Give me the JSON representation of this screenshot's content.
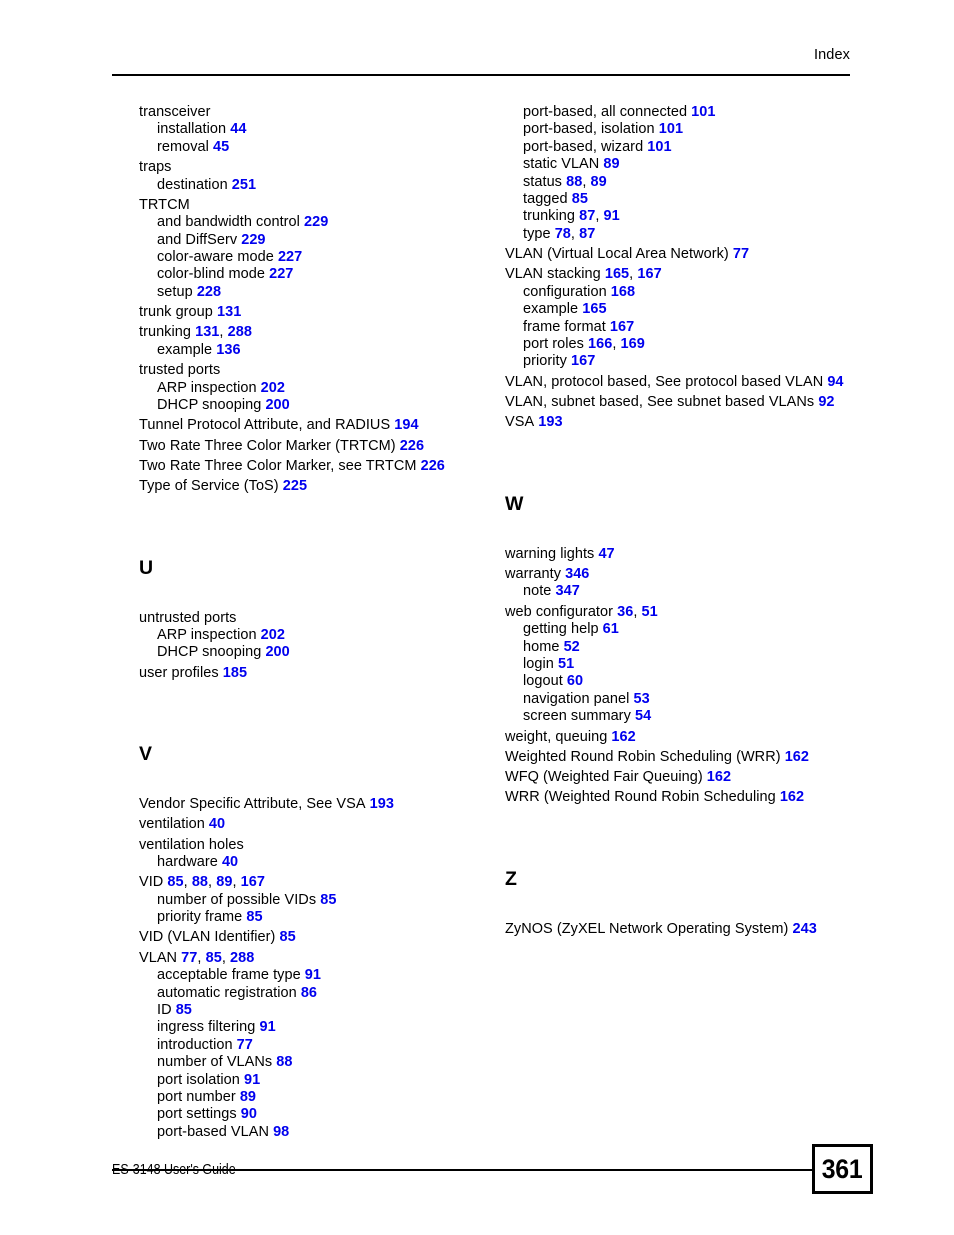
{
  "header": {
    "title": "Index"
  },
  "footer": {
    "guide_label": "ES-3148 User's Guide",
    "page_number": "361"
  },
  "colors": {
    "page_reference": "#0000ee",
    "text": "#000000",
    "background": "#ffffff"
  },
  "columns": {
    "left": [
      {
        "type": "entry",
        "level": 0,
        "text": "transceiver",
        "refs": []
      },
      {
        "type": "entry",
        "level": 1,
        "text": "installation",
        "refs": [
          "44"
        ]
      },
      {
        "type": "entry",
        "level": 1,
        "text": "removal",
        "refs": [
          "45"
        ]
      },
      {
        "type": "entry",
        "level": 0,
        "text": "traps",
        "refs": []
      },
      {
        "type": "entry",
        "level": 1,
        "text": "destination",
        "refs": [
          "251"
        ]
      },
      {
        "type": "entry",
        "level": 0,
        "text": "TRTCM",
        "refs": []
      },
      {
        "type": "entry",
        "level": 1,
        "text": "and bandwidth control",
        "refs": [
          "229"
        ]
      },
      {
        "type": "entry",
        "level": 1,
        "text": "and DiffServ",
        "refs": [
          "229"
        ]
      },
      {
        "type": "entry",
        "level": 1,
        "text": "color-aware mode",
        "refs": [
          "227"
        ]
      },
      {
        "type": "entry",
        "level": 1,
        "text": "color-blind mode",
        "refs": [
          "227"
        ]
      },
      {
        "type": "entry",
        "level": 1,
        "text": "setup",
        "refs": [
          "228"
        ]
      },
      {
        "type": "entry",
        "level": 0,
        "text": "trunk group",
        "refs": [
          "131"
        ]
      },
      {
        "type": "entry",
        "level": 0,
        "text": "trunking",
        "refs": [
          "131",
          "288"
        ]
      },
      {
        "type": "entry",
        "level": 1,
        "text": "example",
        "refs": [
          "136"
        ]
      },
      {
        "type": "entry",
        "level": 0,
        "text": "trusted ports",
        "refs": []
      },
      {
        "type": "entry",
        "level": 1,
        "text": "ARP inspection",
        "refs": [
          "202"
        ]
      },
      {
        "type": "entry",
        "level": 1,
        "text": "DHCP snooping",
        "refs": [
          "200"
        ]
      },
      {
        "type": "entry",
        "level": 0,
        "text": "Tunnel Protocol Attribute, and RADIUS",
        "refs": [
          "194"
        ]
      },
      {
        "type": "entry",
        "level": 0,
        "text": "Two Rate Three Color Marker (TRTCM)",
        "refs": [
          "226"
        ]
      },
      {
        "type": "entry",
        "level": 0,
        "text": "Two Rate Three Color Marker, see TRTCM",
        "refs": [
          "226"
        ]
      },
      {
        "type": "entry",
        "level": 0,
        "text": "Type of Service (ToS)",
        "refs": [
          "225"
        ]
      },
      {
        "type": "heading",
        "text": "U"
      },
      {
        "type": "entry",
        "level": 0,
        "text": "untrusted ports",
        "refs": []
      },
      {
        "type": "entry",
        "level": 1,
        "text": "ARP inspection",
        "refs": [
          "202"
        ]
      },
      {
        "type": "entry",
        "level": 1,
        "text": "DHCP snooping",
        "refs": [
          "200"
        ]
      },
      {
        "type": "entry",
        "level": 0,
        "text": "user profiles",
        "refs": [
          "185"
        ]
      },
      {
        "type": "heading",
        "text": "V"
      },
      {
        "type": "entry",
        "level": 0,
        "text": "Vendor Specific Attribute, See VSA",
        "refs": [
          "193"
        ]
      },
      {
        "type": "entry",
        "level": 0,
        "text": "ventilation",
        "refs": [
          "40"
        ]
      },
      {
        "type": "entry",
        "level": 0,
        "text": "ventilation holes",
        "refs": []
      },
      {
        "type": "entry",
        "level": 1,
        "text": "hardware",
        "refs": [
          "40"
        ]
      },
      {
        "type": "entry",
        "level": 0,
        "text": "VID",
        "refs": [
          "85",
          "88",
          "89",
          "167"
        ]
      },
      {
        "type": "entry",
        "level": 1,
        "text": "number of possible VIDs",
        "refs": [
          "85"
        ]
      },
      {
        "type": "entry",
        "level": 1,
        "text": "priority frame",
        "refs": [
          "85"
        ]
      },
      {
        "type": "entry",
        "level": 0,
        "text": "VID (VLAN Identifier)",
        "refs": [
          "85"
        ]
      },
      {
        "type": "entry",
        "level": 0,
        "text": "VLAN",
        "refs": [
          "77",
          "85",
          "288"
        ]
      },
      {
        "type": "entry",
        "level": 1,
        "text": "acceptable frame type",
        "refs": [
          "91"
        ]
      },
      {
        "type": "entry",
        "level": 1,
        "text": "automatic registration",
        "refs": [
          "86"
        ]
      },
      {
        "type": "entry",
        "level": 1,
        "text": "ID",
        "refs": [
          "85"
        ]
      },
      {
        "type": "entry",
        "level": 1,
        "text": "ingress filtering",
        "refs": [
          "91"
        ]
      },
      {
        "type": "entry",
        "level": 1,
        "text": "introduction",
        "refs": [
          "77"
        ]
      },
      {
        "type": "entry",
        "level": 1,
        "text": "number of VLANs",
        "refs": [
          "88"
        ]
      },
      {
        "type": "entry",
        "level": 1,
        "text": "port isolation",
        "refs": [
          "91"
        ]
      },
      {
        "type": "entry",
        "level": 1,
        "text": "port number",
        "refs": [
          "89"
        ]
      },
      {
        "type": "entry",
        "level": 1,
        "text": "port settings",
        "refs": [
          "90"
        ]
      },
      {
        "type": "entry",
        "level": 1,
        "text": "port-based VLAN",
        "refs": [
          "98"
        ]
      }
    ],
    "right": [
      {
        "type": "entry",
        "level": 1,
        "text": "port-based, all connected",
        "refs": [
          "101"
        ]
      },
      {
        "type": "entry",
        "level": 1,
        "text": "port-based, isolation",
        "refs": [
          "101"
        ]
      },
      {
        "type": "entry",
        "level": 1,
        "text": "port-based, wizard",
        "refs": [
          "101"
        ]
      },
      {
        "type": "entry",
        "level": 1,
        "text": "static VLAN",
        "refs": [
          "89"
        ]
      },
      {
        "type": "entry",
        "level": 1,
        "text": "status",
        "refs": [
          "88",
          "89"
        ]
      },
      {
        "type": "entry",
        "level": 1,
        "text": "tagged",
        "refs": [
          "85"
        ]
      },
      {
        "type": "entry",
        "level": 1,
        "text": "trunking",
        "refs": [
          "87",
          "91"
        ]
      },
      {
        "type": "entry",
        "level": 1,
        "text": "type",
        "refs": [
          "78",
          "87"
        ]
      },
      {
        "type": "entry",
        "level": 0,
        "text": "VLAN (Virtual Local Area Network)",
        "refs": [
          "77"
        ]
      },
      {
        "type": "entry",
        "level": 0,
        "text": "VLAN stacking",
        "refs": [
          "165",
          "167"
        ]
      },
      {
        "type": "entry",
        "level": 1,
        "text": "configuration",
        "refs": [
          "168"
        ]
      },
      {
        "type": "entry",
        "level": 1,
        "text": "example",
        "refs": [
          "165"
        ]
      },
      {
        "type": "entry",
        "level": 1,
        "text": "frame format",
        "refs": [
          "167"
        ]
      },
      {
        "type": "entry",
        "level": 1,
        "text": "port roles",
        "refs": [
          "166",
          "169"
        ]
      },
      {
        "type": "entry",
        "level": 1,
        "text": "priority",
        "refs": [
          "167"
        ]
      },
      {
        "type": "entry",
        "level": 0,
        "text": "VLAN, protocol based, See protocol based VLAN",
        "refs": [
          "94"
        ]
      },
      {
        "type": "entry",
        "level": 0,
        "text": "VLAN, subnet based, See subnet based VLANs",
        "refs": [
          "92"
        ]
      },
      {
        "type": "entry",
        "level": 0,
        "text": "VSA",
        "refs": [
          "193"
        ]
      },
      {
        "type": "heading",
        "text": "W"
      },
      {
        "type": "entry",
        "level": 0,
        "text": "warning lights",
        "refs": [
          "47"
        ]
      },
      {
        "type": "entry",
        "level": 0,
        "text": "warranty",
        "refs": [
          "346"
        ]
      },
      {
        "type": "entry",
        "level": 1,
        "text": "note",
        "refs": [
          "347"
        ]
      },
      {
        "type": "entry",
        "level": 0,
        "text": "web configurator",
        "refs": [
          "36",
          "51"
        ]
      },
      {
        "type": "entry",
        "level": 1,
        "text": "getting help",
        "refs": [
          "61"
        ]
      },
      {
        "type": "entry",
        "level": 1,
        "text": "home",
        "refs": [
          "52"
        ]
      },
      {
        "type": "entry",
        "level": 1,
        "text": "login",
        "refs": [
          "51"
        ]
      },
      {
        "type": "entry",
        "level": 1,
        "text": "logout",
        "refs": [
          "60"
        ]
      },
      {
        "type": "entry",
        "level": 1,
        "text": "navigation panel",
        "refs": [
          "53"
        ]
      },
      {
        "type": "entry",
        "level": 1,
        "text": "screen summary",
        "refs": [
          "54"
        ]
      },
      {
        "type": "entry",
        "level": 0,
        "text": "weight, queuing",
        "refs": [
          "162"
        ]
      },
      {
        "type": "entry",
        "level": 0,
        "text": "Weighted Round Robin Scheduling (WRR)",
        "refs": [
          "162"
        ]
      },
      {
        "type": "entry",
        "level": 0,
        "text": "WFQ (Weighted Fair Queuing)",
        "refs": [
          "162"
        ]
      },
      {
        "type": "entry",
        "level": 0,
        "text": "WRR (Weighted Round Robin Scheduling",
        "refs": [
          "162"
        ]
      },
      {
        "type": "heading",
        "text": "Z"
      },
      {
        "type": "entry",
        "level": 0,
        "text": "ZyNOS (ZyXEL Network Operating System)",
        "refs": [
          "243"
        ]
      }
    ]
  }
}
